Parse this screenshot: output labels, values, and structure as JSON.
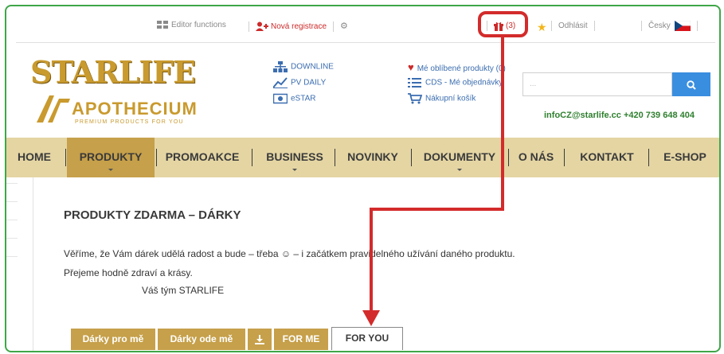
{
  "topbar": {
    "editor_label": "Editor functions",
    "register_label": "Nová registrace",
    "gift_count": "(3)",
    "logout_label": "Odhlásit",
    "language_label": "Česky"
  },
  "logo": {
    "starlife": "STARLIFE",
    "apothecium": "APOTHECIUM",
    "apothecium_sub": "PREMIUM PRODUCTS FOR YOU"
  },
  "header_links": {
    "downline": "DOWNLINE",
    "pv_daily": "PV DAILY",
    "estar": "eSTAR",
    "favorites": "Mé oblíbené produkty (0)",
    "cds_orders": "CDS - Mé objednávky",
    "cart": "Nákupní košík"
  },
  "search": {
    "placeholder": "..."
  },
  "contact": "infoCZ@starlife.cc +420 739 648 404",
  "nav": [
    "HOME",
    "PRODUKTY",
    "PROMOAKCE",
    "BUSINESS",
    "NOVINKY",
    "DOKUMENTY",
    "O NÁS",
    "KONTAKT",
    "E-SHOP"
  ],
  "content": {
    "title": "PRODUKTY ZDARMA – DÁRKY",
    "line1": "Věříme, že Vám dárek udělá radost a bude – třeba ☺ – i začátkem pravidelného užívání daného produktu.",
    "line2": "Přejeme hodně zdraví a krásy.",
    "line3": "Váš tým STARLIFE"
  },
  "tabs": [
    "Dárky pro mě",
    "Dárky ode mě",
    "FOR ME",
    "FOR YOU"
  ],
  "colors": {
    "gold": "#c6a04a",
    "nav_bg": "#e4d5a3",
    "annotation": "#d32b2b",
    "frame": "#3fa648"
  }
}
